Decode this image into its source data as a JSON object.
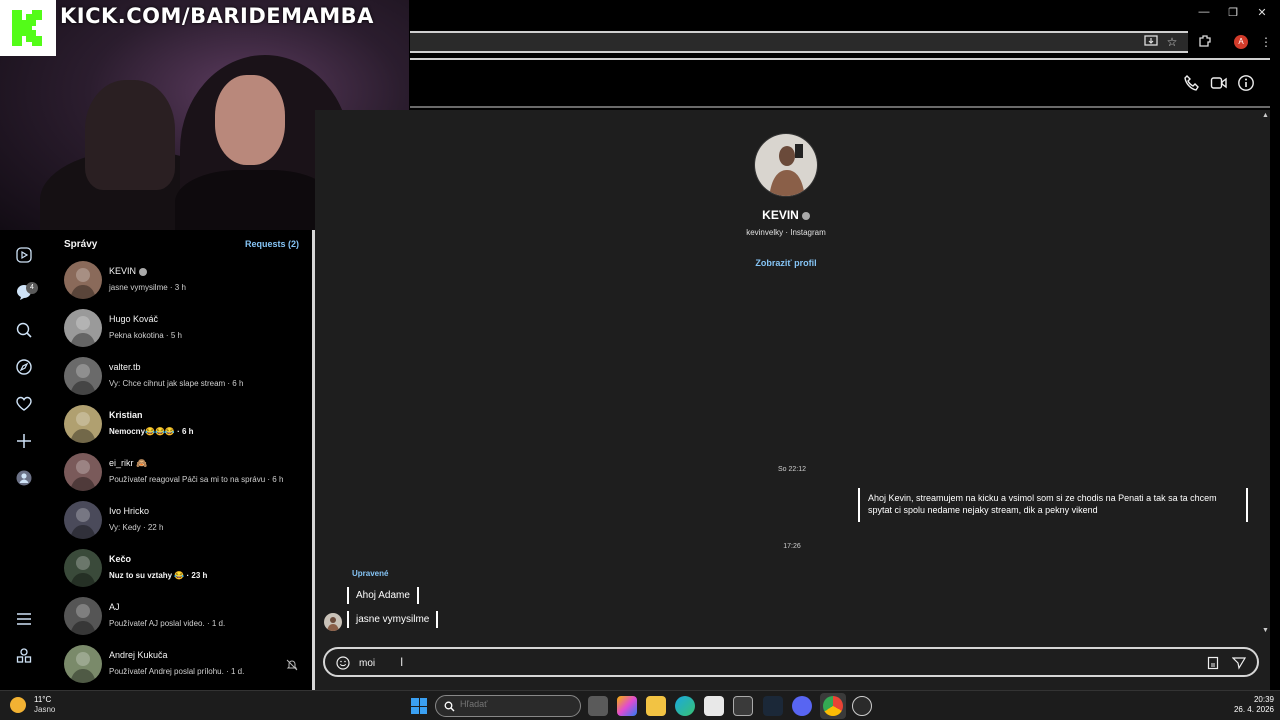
{
  "browser": {
    "window_controls": {
      "minimize": "—",
      "restore": "❐",
      "close": "✕"
    },
    "profile_initial": "A"
  },
  "stream_overlay": {
    "url_text": "KICK.COM/BARIDEMAMBA"
  },
  "sidebar": {
    "title": "Správy",
    "requests": "Requests (2)",
    "notification_count": "4"
  },
  "conversations": [
    {
      "name": "KEVIN",
      "verified": true,
      "preview": "jasne vymysilme · 3 h",
      "bold": false
    },
    {
      "name": "Hugo Kováč",
      "verified": false,
      "preview": "Pekna kokotina · 5 h",
      "bold": false
    },
    {
      "name": "valter.tb",
      "verified": false,
      "preview": "Vy: Chce cihnut jak slape stream · 6 h",
      "bold": false
    },
    {
      "name": "Kristian",
      "verified": false,
      "preview": "Nemocny😂😂😂 · 6 h",
      "bold": true
    },
    {
      "name": "ei_rikr 🙈",
      "verified": false,
      "preview": "Používateľ reagoval Páči sa mi to na správu · 6 h",
      "bold": false
    },
    {
      "name": "Ivo Hricko",
      "verified": false,
      "preview": "Vy: Kedy · 22 h",
      "bold": false
    },
    {
      "name": "Kečo",
      "verified": false,
      "preview": "Nuz to su vztahy 😂 · 23 h",
      "bold": true
    },
    {
      "name": "AJ",
      "verified": false,
      "preview": "Používateľ AJ poslal video. · 1 d.",
      "bold": false
    },
    {
      "name": "Andrej Kukuča",
      "verified": false,
      "preview": "Používateľ Andrej poslal prílohu. · 1 d.",
      "bold": false
    }
  ],
  "chat": {
    "profile_name": "KEVIN",
    "profile_sub": "kevinvelky · Instagram",
    "view_profile": "Zobraziť profil",
    "timestamp_1": "So 22:12",
    "outgoing_message": "Ahoj Kevin, streamujem na kicku a vsimol som si ze chodis na Penati a tak sa ta chcem spytat ci spolu nedame nejaky stream, dik a pekny vikend",
    "timestamp_2": "17:26",
    "edited_label": "Upravené",
    "incoming_1": "Ahoj Adame",
    "incoming_2": "jasne vymysilme"
  },
  "composer": {
    "value": "moi"
  },
  "taskbar": {
    "temperature": "11°C",
    "weather": "Jasno",
    "search_placeholder": "Hľadať",
    "time": "20:39",
    "date": "26. 4. 2026"
  },
  "colors": {
    "accent_link": "#85c4f5",
    "kick_green": "#53fc18",
    "chat_bg": "#1e1e1e"
  },
  "icons": {
    "header": [
      "phone-icon",
      "video-icon",
      "info-icon"
    ],
    "nav": [
      "reels-icon",
      "messenger-icon",
      "search-icon",
      "explore-icon",
      "heart-icon",
      "plus-icon",
      "profile-icon",
      "menu-icon",
      "threads-icon"
    ]
  }
}
